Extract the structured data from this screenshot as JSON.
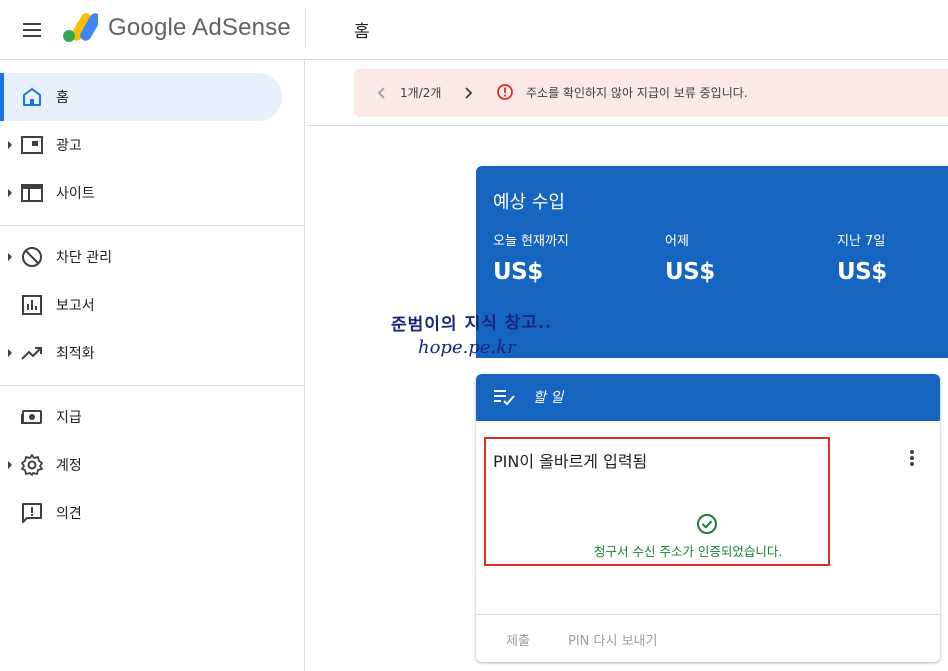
{
  "header": {
    "brand": "Google AdSense",
    "page_title": "홈"
  },
  "sidebar": {
    "items": [
      {
        "label": "홈",
        "icon": "home-icon",
        "active": true
      },
      {
        "label": "광고",
        "icon": "ads-icon"
      },
      {
        "label": "사이트",
        "icon": "sites-icon"
      },
      {
        "label": "차단 관리",
        "icon": "block-icon"
      },
      {
        "label": "보고서",
        "icon": "reports-icon"
      },
      {
        "label": "최적화",
        "icon": "trending-up-icon"
      },
      {
        "label": "지급",
        "icon": "payments-icon"
      },
      {
        "label": "계정",
        "icon": "gear-icon"
      },
      {
        "label": "의견",
        "icon": "feedback-icon"
      }
    ]
  },
  "alert": {
    "pager": "1개/2개",
    "message": "주소를 확인하지 않아 지급이 보류 중입니다."
  },
  "earnings": {
    "title": "예상 수입",
    "columns": [
      {
        "label": "오늘 현재까지",
        "value": "US$"
      },
      {
        "label": "어제",
        "value": "US$"
      },
      {
        "label": "지난 7일",
        "value": "US$"
      }
    ]
  },
  "watermark": {
    "line1": "준범이의 지식 창고..",
    "line2": "hope.pe.kr"
  },
  "todo": {
    "title": "할 일",
    "pin_title": "PIN이 올바르게 입력됨",
    "pin_status": "청구서 수신 주소가 인증되었습니다.",
    "submit_label": "제출",
    "resend_label": "PIN 다시 보내기"
  },
  "colors": {
    "brand_blue": "#1565c0",
    "active_nav": "#e8f0fe",
    "alert_bg": "#fce8e6",
    "error_red": "#d93025",
    "success_green": "#188038"
  }
}
